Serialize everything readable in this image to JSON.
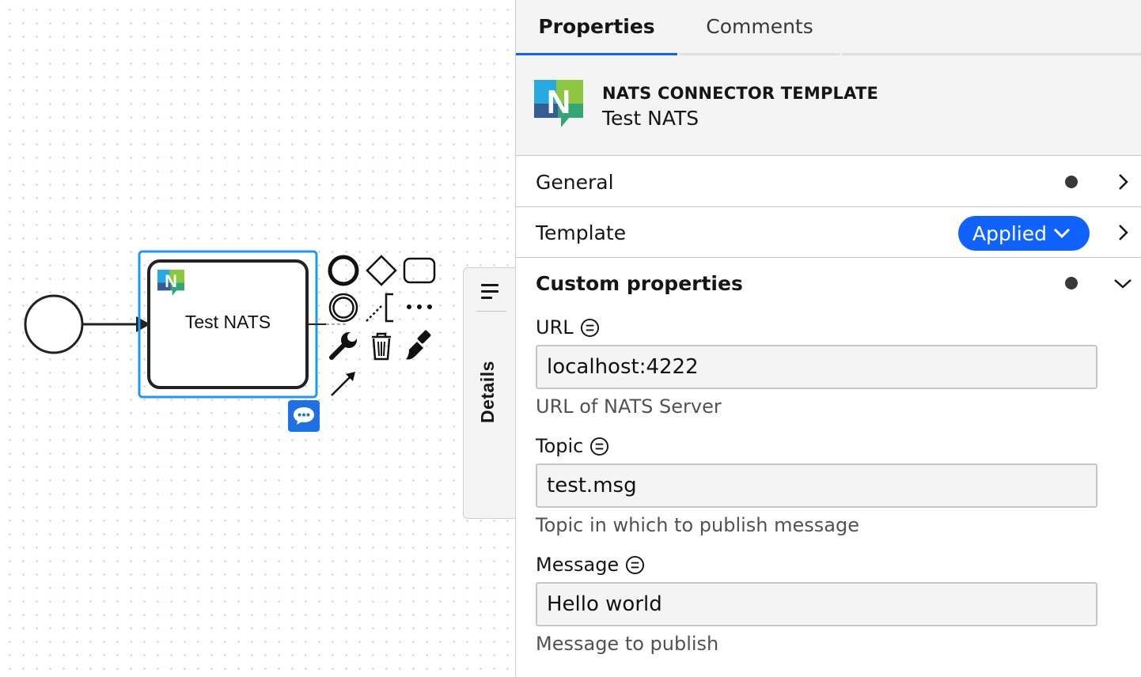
{
  "canvas": {
    "task_label": "Test NATS"
  },
  "details_tab": {
    "label": "Details"
  },
  "panel": {
    "tabs": [
      {
        "label": "Properties",
        "active": true
      },
      {
        "label": "Comments",
        "active": false
      }
    ],
    "header": {
      "type": "NATS CONNECTOR TEMPLATE",
      "name": "Test NATS"
    },
    "groups": {
      "general": {
        "label": "General"
      },
      "template": {
        "label": "Template",
        "status": "Applied"
      },
      "custom": {
        "label": "Custom properties"
      }
    },
    "fields": [
      {
        "label": "URL",
        "value": "localhost:4222",
        "description": "URL of NATS Server"
      },
      {
        "label": "Topic",
        "value": "test.msg",
        "description": "Topic in which to publish message"
      },
      {
        "label": "Message",
        "value": "Hello world",
        "description": "Message to publish"
      }
    ]
  },
  "colors": {
    "accent": "#0f62fe",
    "selection": "#2196f3",
    "comment_badge": "#1f6fe5"
  }
}
